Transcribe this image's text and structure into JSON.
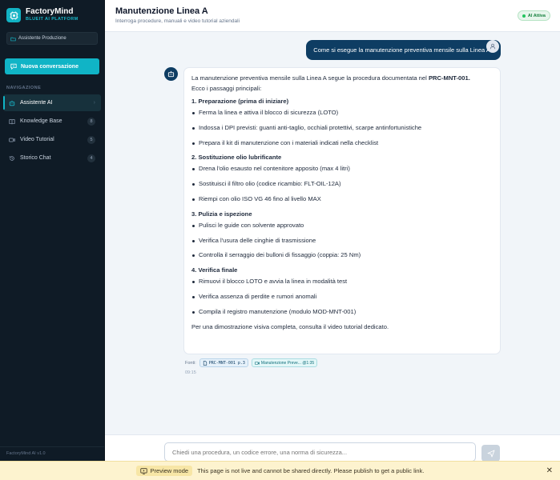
{
  "brand": {
    "name": "FactoryMind",
    "subtitle": "BLUEIT AI PLATFORM"
  },
  "sidebar": {
    "role_select": "Assistente Produzione",
    "new_conversation": "Nuova conversazione",
    "nav_label": "NAVIGAZIONE",
    "items": [
      {
        "label": "Assistente AI",
        "count": "",
        "active": true
      },
      {
        "label": "Knowledge Base",
        "count": "8"
      },
      {
        "label": "Video Tutorial",
        "count": "5"
      },
      {
        "label": "Storico Chat",
        "count": "4"
      }
    ],
    "footer": "FactoryMind AI v1.0"
  },
  "header": {
    "title": "Manutenzione Linea A",
    "subtitle": "Interroga procedure, manuali e video tutorial aziendali",
    "status": "AI Attiva",
    "status_color": "#15803d"
  },
  "chat": {
    "user_message": "Come si esegue la manutenzione preventiva mensile sulla Linea A?",
    "assistant": {
      "intro_text": "La manutenzione preventiva mensile sulla Linea A segue la procedura documentata nel ",
      "intro_code": "PRC-MNT-001.",
      "intro_line2": "Ecco i passaggi principali:",
      "sections": [
        {
          "title": "1. Preparazione (prima di iniziare)",
          "items": [
            "Ferma la linea e attiva il blocco di sicurezza (LOTO)",
            "Indossa i DPI previsti: guanti anti-taglio, occhiali protettivi, scarpe antinfortunistiche",
            "Prepara il kit di manutenzione con i materiali indicati nella checklist"
          ]
        },
        {
          "title": "2. Sostituzione olio lubrificante",
          "items": [
            "Drena l'olio esausto nel contenitore apposito (max 4 litri)",
            "Sostituisci il filtro olio (codice ricambio: FLT-OIL-12A)",
            "Riempi con olio ISO VG 46 fino al livello MAX"
          ]
        },
        {
          "title": "3. Pulizia e ispezione",
          "items": [
            "Pulisci le guide con solvente approvato",
            "Verifica l'usura delle cinghie di trasmissione",
            "Controlla il serraggio dei bulloni di fissaggio (coppia: 25 Nm)"
          ]
        },
        {
          "title": "4. Verifica finale",
          "items": [
            "Rimuovi il blocco LOTO e avvia la linea in modalità test",
            "Verifica assenza di perdite e rumori anomali",
            "Compila il registro manutenzione (modulo MOD-MNT-001)"
          ]
        }
      ],
      "closing": "Per una dimostrazione visiva completa, consulta il video tutorial dedicato."
    },
    "sources_label": "Fonti:",
    "sources": [
      {
        "icon": "document-icon",
        "label": "PRC-MNT-001 p.3"
      },
      {
        "icon": "video-icon",
        "label": "Manutenzione Preve... @1:35"
      }
    ],
    "time": "09:15"
  },
  "input": {
    "placeholder": "Chiedi una procedura, un codice errore, una norma di sicurezza..."
  },
  "preview_banner": {
    "pill": "Preview mode",
    "message": "This page is not live and cannot be shared directly. Please publish to get a public link."
  }
}
